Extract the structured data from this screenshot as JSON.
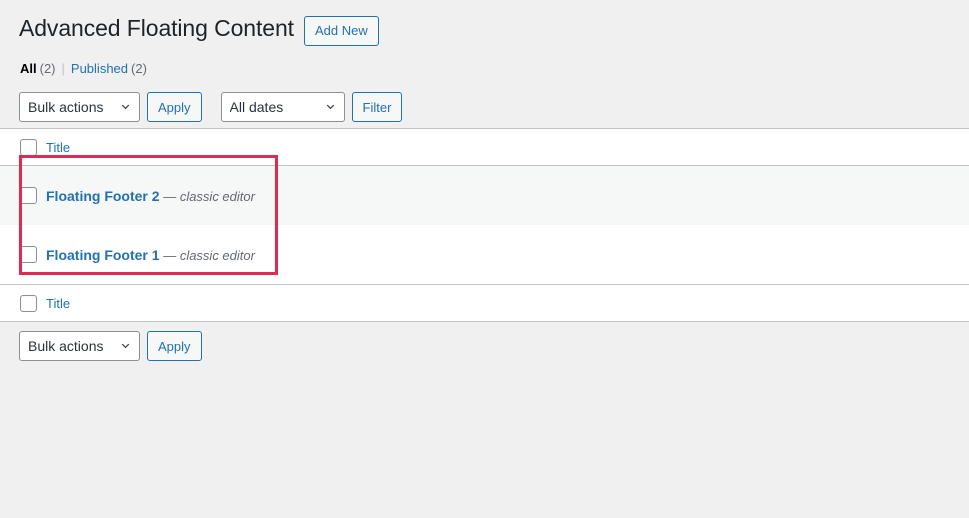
{
  "header": {
    "title": "Advanced Floating Content",
    "add_new_label": "Add New"
  },
  "status_links": {
    "all_label": "All",
    "all_count": "(2)",
    "separator": "|",
    "published_label": "Published",
    "published_count": "(2)"
  },
  "tablenav_top": {
    "bulk_actions_value": "Bulk actions",
    "apply_label": "Apply",
    "dates_value": "All dates",
    "filter_label": "Filter"
  },
  "tablenav_bottom": {
    "bulk_actions_value": "Bulk actions",
    "apply_label": "Apply"
  },
  "table": {
    "columns": {
      "title": "Title"
    },
    "rows": [
      {
        "title": "Floating Footer 2",
        "dash": "—",
        "state": "classic editor"
      },
      {
        "title": "Floating Footer 1",
        "dash": "—",
        "state": "classic editor"
      }
    ]
  },
  "colors": {
    "accent_blue": "#2271b1",
    "highlight_red": "#e02a52",
    "page_background": "#f0f0f1",
    "muted_text": "#646970",
    "title_text": "#1d2327"
  }
}
